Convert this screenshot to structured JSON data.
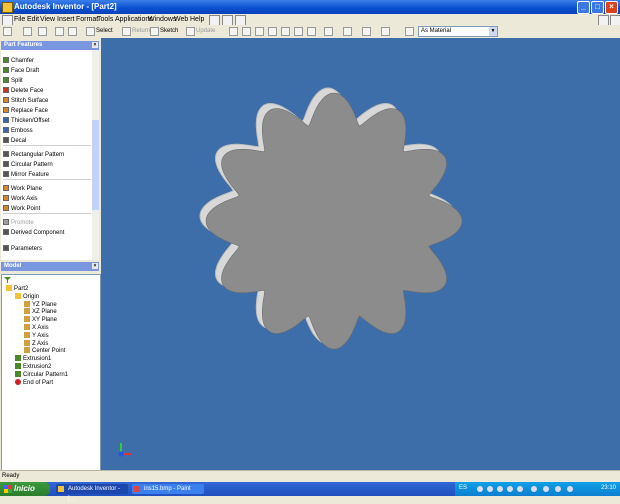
{
  "window": {
    "title": "Autodesk Inventor - [Part2]"
  },
  "menu": [
    "File",
    "Edit",
    "View",
    "Insert",
    "Format",
    "Tools",
    "Applications",
    "Windows",
    "Web",
    "Help"
  ],
  "toolbar": {
    "select": "Select",
    "return": "Return",
    "sketch": "Sketch",
    "update": "Update",
    "material": "As Material"
  },
  "features_panel": {
    "title": "Part Features",
    "items": [
      {
        "label": "Chamfer",
        "color": "#4a8a2a",
        "enabled": true
      },
      {
        "label": "Face Draft",
        "color": "#4a8a2a",
        "enabled": true
      },
      {
        "label": "Split",
        "color": "#4a8a2a",
        "enabled": true
      },
      {
        "label": "Delete Face",
        "color": "#cc3322",
        "enabled": true
      },
      {
        "label": "Stitch Surface",
        "color": "#d08a2a",
        "enabled": true
      },
      {
        "label": "Replace Face",
        "color": "#d08a2a",
        "enabled": true
      },
      {
        "label": "Thicken/Offset",
        "color": "#3a6ab0",
        "enabled": true
      },
      {
        "label": "Emboss",
        "color": "#3a6ab0",
        "enabled": true
      },
      {
        "label": "Decal",
        "color": "#555555",
        "enabled": true
      },
      {
        "label": "Rectangular Pattern",
        "color": "#555555",
        "enabled": true
      },
      {
        "label": "Circular Pattern",
        "color": "#555555",
        "enabled": true
      },
      {
        "label": "Mirror Feature",
        "color": "#555555",
        "enabled": true
      },
      {
        "label": "Work Plane",
        "color": "#d08a2a",
        "enabled": true
      },
      {
        "label": "Work Axis",
        "color": "#d08a2a",
        "enabled": true
      },
      {
        "label": "Work Point",
        "color": "#d08a2a",
        "enabled": true
      },
      {
        "label": "Promote",
        "color": "#a0a0a0",
        "enabled": false
      },
      {
        "label": "Derived Component",
        "color": "#555555",
        "enabled": true
      }
    ],
    "parameters": "Parameters"
  },
  "model_panel": {
    "title": "Model",
    "tree": [
      {
        "label": "Part2",
        "depth": 0,
        "icon": "part"
      },
      {
        "label": "Origin",
        "depth": 1,
        "icon": "folder"
      },
      {
        "label": "YZ Plane",
        "depth": 2,
        "icon": "plane"
      },
      {
        "label": "XZ Plane",
        "depth": 2,
        "icon": "plane"
      },
      {
        "label": "XY Plane",
        "depth": 2,
        "icon": "plane"
      },
      {
        "label": "X Axis",
        "depth": 2,
        "icon": "axis"
      },
      {
        "label": "Y Axis",
        "depth": 2,
        "icon": "axis"
      },
      {
        "label": "Z Axis",
        "depth": 2,
        "icon": "axis"
      },
      {
        "label": "Center Point",
        "depth": 2,
        "icon": "point"
      },
      {
        "label": "Extrusion1",
        "depth": 1,
        "icon": "feature"
      },
      {
        "label": "Extrusion2",
        "depth": 1,
        "icon": "feature"
      },
      {
        "label": "Circular Pattern1",
        "depth": 1,
        "icon": "pattern"
      },
      {
        "label": "End of Part",
        "depth": 1,
        "icon": "end"
      }
    ]
  },
  "viewport": {
    "background": "#3d6ea9",
    "part_color": "#8c8c8c"
  },
  "status": {
    "text": "Ready"
  },
  "taskbar": {
    "start": "Inicio",
    "tasks": [
      "Autodesk Inventor - [...",
      "ins15.bmp - Paint"
    ],
    "language": "ES",
    "clock": "23:10"
  }
}
